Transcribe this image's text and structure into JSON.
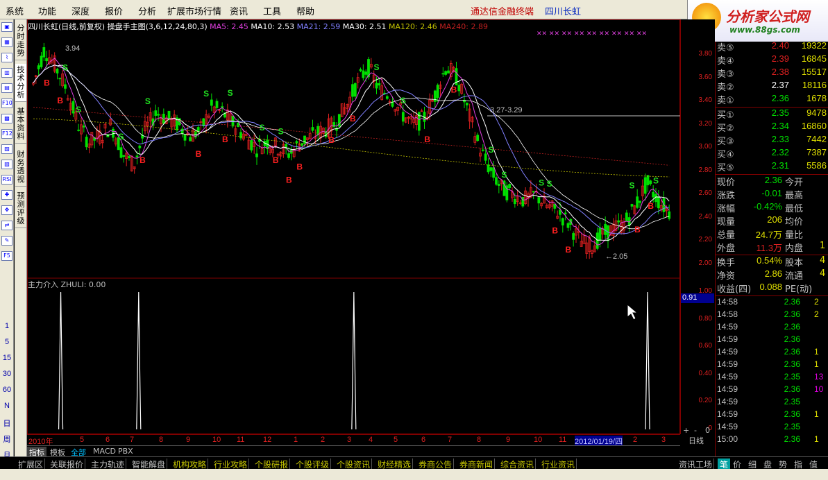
{
  "menu": [
    "系统",
    "功能",
    "深度",
    "报价",
    "分析",
    "扩展市场行情",
    "资讯",
    "工具",
    "帮助"
  ],
  "menu_right": {
    "terminal": "通达信金融终端",
    "stock": "四川长虹"
  },
  "logo": {
    "title": "分析家公式网",
    "url": "www.88gs.com"
  },
  "vtabs": [
    "分时走势",
    "技术分析",
    "基本资料",
    "财务透视",
    "预测评级"
  ],
  "left_icons": [
    "▣",
    "▦",
    "⌇",
    "▥",
    "▤",
    "F10",
    "▩",
    "F12",
    "▨",
    "▧",
    "RSI",
    "✚",
    "✥",
    "⇄",
    "✎",
    "F5"
  ],
  "left_periods": [
    "1",
    "5",
    "15",
    "30",
    "60",
    "N",
    "日",
    "周",
    "月"
  ],
  "chart_header": {
    "title": "四川长虹(日线,前复权)",
    "indicator": "操盘手主图(3,6,12,24,80,3)",
    "ma": [
      {
        "label": "MA5: 2.45",
        "color": "#e040e0"
      },
      {
        "label": "MA10: 2.53",
        "color": "#ffffff"
      },
      {
        "label": "MA21: 2.59",
        "color": "#8080ff"
      },
      {
        "label": "MA30: 2.51",
        "color": "#ffffff"
      },
      {
        "label": "MA120: 2.46",
        "color": "#c0c000"
      },
      {
        "label": "MA240: 2.89",
        "color": "#c02020"
      }
    ]
  },
  "sub_header": "主力介入  ZHULI: 0.00",
  "price_axis": [
    "3.80",
    "3.60",
    "3.40",
    "3.20",
    "3.00",
    "2.80",
    "2.60",
    "2.40",
    "2.20",
    "2.00"
  ],
  "sub_axis": [
    "1.00",
    "0.80",
    "0.60",
    "0.40",
    "0.20",
    "0"
  ],
  "sub_value": "0.91",
  "annotations": {
    "high": "3.94",
    "low": "2.05",
    "range": "3.27-3.29"
  },
  "x_labels": [
    "2010年",
    "5",
    "6",
    "7",
    "8",
    "9",
    "10",
    "11",
    "12",
    "1",
    "2",
    "3",
    "4",
    "5",
    "6",
    "7",
    "8",
    "9",
    "10",
    "11",
    "2012/01/19/四",
    "2",
    "3"
  ],
  "x_right": "日线",
  "bottom_tabs": [
    "指标",
    "模板",
    "全部",
    "MACD",
    "PBX"
  ],
  "bottom_bar": [
    "扩展区",
    "关联报价",
    "主力轨迹",
    "智能解盘",
    "机构攻略",
    "行业攻略",
    "个股研报",
    "个股评级",
    "个股资讯",
    "财经精选",
    "券商公告",
    "券商新闻",
    "综合资讯",
    "行业资讯"
  ],
  "bottom_right": "资讯工场",
  "right_tabs": [
    "笔",
    "价",
    "细",
    "盘",
    "势",
    "指",
    "值"
  ],
  "order_book": {
    "sell": [
      {
        "label": "卖⑤",
        "price": "2.40",
        "vol": "19322"
      },
      {
        "label": "卖④",
        "price": "2.39",
        "vol": "16845"
      },
      {
        "label": "卖③",
        "price": "2.38",
        "vol": "15517"
      },
      {
        "label": "卖②",
        "price": "2.37",
        "vol": "18116"
      },
      {
        "label": "卖①",
        "price": "2.36",
        "vol": "1678"
      }
    ],
    "buy": [
      {
        "label": "买①",
        "price": "2.35",
        "vol": "9478"
      },
      {
        "label": "买②",
        "price": "2.34",
        "vol": "16860"
      },
      {
        "label": "买③",
        "price": "2.33",
        "vol": "7442"
      },
      {
        "label": "买④",
        "price": "2.32",
        "vol": "7387"
      },
      {
        "label": "买⑤",
        "price": "2.31",
        "vol": "5586"
      }
    ]
  },
  "quote": [
    {
      "l": "现价",
      "v": "2.36",
      "c": "#00e000",
      "l2": "今开",
      "v2": ""
    },
    {
      "l": "涨跌",
      "v": "-0.01",
      "c": "#00e000",
      "l2": "最高",
      "v2": ""
    },
    {
      "l": "涨幅",
      "v": "-0.42%",
      "c": "#00e000",
      "l2": "最低",
      "v2": ""
    },
    {
      "l": "现量",
      "v": "206",
      "c": "#e0e000",
      "l2": "均价",
      "v2": ""
    },
    {
      "l": "总量",
      "v": "24.7万",
      "c": "#e0e000",
      "l2": "量比",
      "v2": ""
    },
    {
      "l": "外盘",
      "v": "11.3万",
      "c": "#e02020",
      "l2": "内盘",
      "v2": "1"
    }
  ],
  "quote2": [
    {
      "l": "换手",
      "v": "0.54%",
      "c": "#e0e000",
      "l2": "股本",
      "v2": "4"
    },
    {
      "l": "净资",
      "v": "2.86",
      "c": "#e0e000",
      "l2": "流通",
      "v2": "4"
    },
    {
      "l": "收益(四)",
      "v": "0.088",
      "c": "#e0e000",
      "l2": "PE(动)",
      "v2": ""
    }
  ],
  "ticks": [
    {
      "t": "14:58",
      "p": "2.36",
      "v": "2",
      "pc": "#00e000",
      "vc": "#e0e000"
    },
    {
      "t": "14:58",
      "p": "2.36",
      "v": "2",
      "pc": "#00e000",
      "vc": "#e0e000"
    },
    {
      "t": "14:59",
      "p": "2.36",
      "v": "",
      "pc": "#00e000",
      "vc": "#e0e000"
    },
    {
      "t": "14:59",
      "p": "2.36",
      "v": "",
      "pc": "#00e000",
      "vc": "#e0e000"
    },
    {
      "t": "14:59",
      "p": "2.36",
      "v": "1",
      "pc": "#00e000",
      "vc": "#e0e000"
    },
    {
      "t": "14:59",
      "p": "2.36",
      "v": "1",
      "pc": "#00e000",
      "vc": "#e0e000"
    },
    {
      "t": "14:59",
      "p": "2.35",
      "v": "13",
      "pc": "#00e000",
      "vc": "#e000e0"
    },
    {
      "t": "14:59",
      "p": "2.36",
      "v": "10",
      "pc": "#00e000",
      "vc": "#e000e0"
    },
    {
      "t": "14:59",
      "p": "2.35",
      "v": "",
      "pc": "#00e000",
      "vc": "#e0e000"
    },
    {
      "t": "14:59",
      "p": "2.36",
      "v": "1",
      "pc": "#00e000",
      "vc": "#e0e000"
    },
    {
      "t": "14:59",
      "p": "2.35",
      "v": "",
      "pc": "#00e000",
      "vc": "#e0e000"
    },
    {
      "t": "15:00",
      "p": "2.36",
      "v": "1",
      "pc": "#00e000",
      "vc": "#e0e000"
    }
  ],
  "colors": {
    "up": "#e02020",
    "down": "#00e000",
    "axis": "#800000",
    "buy_mark": "#ff2020",
    "sell_mark": "#20e020"
  },
  "chart_data": {
    "type": "candlestick",
    "ylim": [
      1.95,
      3.98
    ],
    "y_ticks": [
      2.0,
      2.2,
      2.4,
      2.6,
      2.8,
      3.0,
      3.2,
      3.4,
      3.6,
      3.8
    ],
    "close_trend": [
      3.55,
      3.85,
      3.7,
      3.5,
      3.2,
      3.05,
      3.1,
      3.2,
      2.95,
      2.85,
      3.15,
      3.3,
      3.25,
      3.2,
      3.1,
      3.15,
      3.35,
      3.3,
      3.2,
      3.1,
      3.0,
      3.05,
      3.0,
      2.95,
      3.05,
      3.1,
      3.15,
      3.2,
      3.35,
      3.55,
      3.7,
      3.5,
      3.45,
      3.3,
      3.2,
      3.25,
      3.45,
      3.7,
      3.6,
      3.3,
      3.0,
      2.8,
      2.65,
      2.6,
      2.55,
      2.6,
      2.5,
      2.45,
      2.35,
      2.2,
      2.15,
      2.25,
      2.3,
      2.35,
      2.5,
      2.7,
      2.55,
      2.45
    ],
    "zhuli_spikes": [
      0.043,
      0.165,
      0.502,
      0.962
    ],
    "zhuli_peak": 1.0
  }
}
